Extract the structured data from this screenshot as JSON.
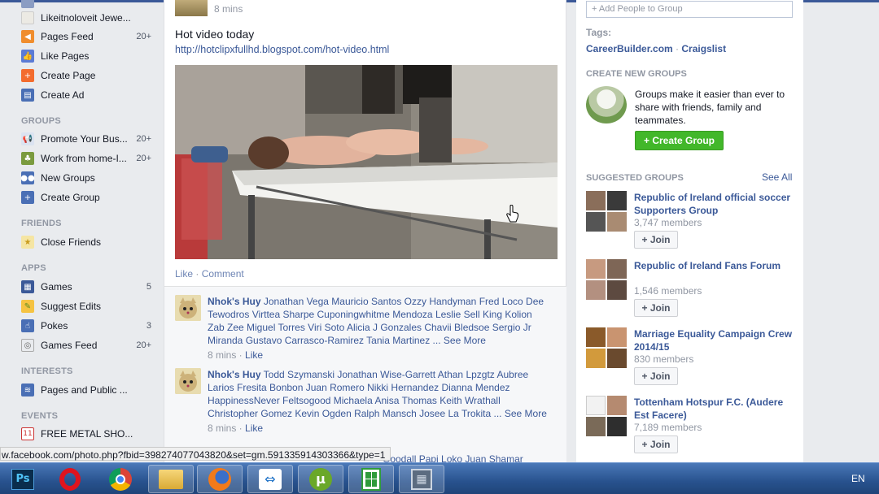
{
  "sidebar": {
    "top_items": [
      {
        "label": "Likeitnoloveit Jewe...",
        "count": ""
      },
      {
        "label": "Pages Feed",
        "count": "20+"
      },
      {
        "label": "Like Pages",
        "count": ""
      },
      {
        "label": "Create Page",
        "count": ""
      },
      {
        "label": "Create Ad",
        "count": ""
      }
    ],
    "groups_header": "GROUPS",
    "groups": [
      {
        "label": "Promote Your Bus...",
        "count": "20+"
      },
      {
        "label": "Work from home-I...",
        "count": "20+"
      },
      {
        "label": "New Groups",
        "count": ""
      },
      {
        "label": "Create Group",
        "count": ""
      }
    ],
    "friends_header": "FRIENDS",
    "friends": [
      {
        "label": "Close Friends",
        "count": ""
      }
    ],
    "apps_header": "APPS",
    "apps": [
      {
        "label": "Games",
        "count": "5"
      },
      {
        "label": "Suggest Edits",
        "count": ""
      },
      {
        "label": "Pokes",
        "count": "3"
      },
      {
        "label": "Games Feed",
        "count": "20+"
      }
    ],
    "interests_header": "INTERESTS",
    "interests": [
      {
        "label": "Pages and Public ...",
        "count": ""
      }
    ],
    "events_header": "EVENTS",
    "events": [
      {
        "label": "FREE METAL SHO...",
        "count": "",
        "day": "11"
      }
    ]
  },
  "post": {
    "time": "8 mins",
    "text": "Hot video today",
    "url": "http://hotclipxfullhd.blogspot.com/hot-video.html",
    "like": "Like",
    "dot": " · ",
    "comment": "Comment"
  },
  "comments": [
    {
      "author": "Nhok's Huy",
      "text": "Jonathan Vega Mauricio Santos Ozzy Handyman Fred Loco Dee Tewodros Virttea Sharpe Cuponingwhitme Mendoza Leslie Sell King Kolion Zab Zee Miguel Torres Viri Soto Alicia J Gonzales Chavii Bledsoe Sergio Jr Miranda Gustavo Carrasco-Ramirez Tania Martinez ...",
      "see_more": "See More",
      "time": "8 mins",
      "like": "Like"
    },
    {
      "author": "Nhok's Huy",
      "text": "Todd Szymanski Jonathan Wise-Garrett Athan Lpzgtz Aubree Larios Fresita Bonbon Juan Romero Nikki Hernandez Dianna Mendez HappinessNever Feltsogood Michaela Anisa Thomas Keith Wrathall Christopher Gomez Kevin Ogden Ralph Mansch Josee La Trokita ...",
      "see_more": "See More",
      "time": "8 mins",
      "like": "Like"
    }
  ],
  "right": {
    "add_people_placeholder": "+ Add People to Group",
    "tags_header": "Tags:",
    "tags": [
      "CareerBuilder.com",
      "Craigslist"
    ],
    "tags_sep": " · ",
    "create_groups_header": "CREATE NEW GROUPS",
    "create_groups_text": "Groups make it easier than ever to share with friends, family and teammates.",
    "create_group_button": "+ Create Group",
    "suggested_header": "SUGGESTED GROUPS",
    "see_all": "See All",
    "join_label": "+ Join",
    "groups": [
      {
        "name": "Republic of Ireland official soccer Supporters Group",
        "members": "3,747 members"
      },
      {
        "name": "Republic of Ireland Fans Forum",
        "members": "1,546 members"
      },
      {
        "name": "Marriage Equality Campaign Crew 2014/15",
        "members": "830 members"
      },
      {
        "name": "Tottenham Hotspur F.C. (Audere Est Facere)",
        "members": "7,189 members"
      }
    ]
  },
  "status_url": "w.facebook.com/photo.php?fbid=398274077043820&set=gm.591335914303366&type=1",
  "under_status_text": "Goodall Papi Loko Juan Shamar",
  "taskbar": {
    "apps": [
      "photoshop-icon",
      "opera-icon",
      "chrome-icon",
      "explorer-icon",
      "firefox-icon",
      "teamviewer-icon",
      "utorrent-icon",
      "spreadsheet-icon",
      "video-icon"
    ],
    "lang": "EN"
  }
}
